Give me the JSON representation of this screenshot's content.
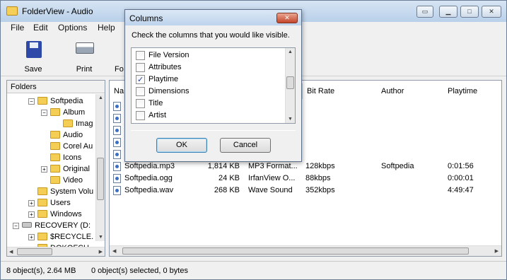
{
  "window": {
    "title": "FolderView - Audio"
  },
  "menu": {
    "items": [
      "File",
      "Edit",
      "Options",
      "Help"
    ]
  },
  "toolbar": {
    "buttons": [
      {
        "label": "Save"
      },
      {
        "label": "Print"
      },
      {
        "label": "Fo"
      }
    ]
  },
  "folders": {
    "header": "Folders",
    "tree": [
      {
        "label": "Softpedia",
        "expander": "−"
      },
      {
        "label": "Album",
        "expander": "−"
      },
      {
        "label": "Imag",
        "expander": ""
      },
      {
        "label": "Audio",
        "expander": ""
      },
      {
        "label": "Corel Au",
        "expander": ""
      },
      {
        "label": "Icons",
        "expander": ""
      },
      {
        "label": "Original",
        "expander": "+"
      },
      {
        "label": "Video",
        "expander": ""
      },
      {
        "label": "System Volu",
        "expander": ""
      },
      {
        "label": "Users",
        "expander": "+"
      },
      {
        "label": "Windows",
        "expander": "+"
      },
      {
        "label": "RECOVERY (D:",
        "expander": "−"
      },
      {
        "label": "$RECYCLE.",
        "expander": "+"
      },
      {
        "label": "DOKOFCH",
        "expander": ""
      }
    ]
  },
  "list": {
    "columns": [
      "Na",
      "Bit Rate",
      "Author",
      "Playtime"
    ],
    "files": [
      {
        "name": "Softpedia.mp3",
        "size": "1,814 KB",
        "type": "MP3 Format...",
        "bitrate": "128kbps",
        "author": "Softpedia",
        "playtime": "0:01:56"
      },
      {
        "name": "Softpedia.ogg",
        "size": "24 KB",
        "type": "IrfanView O...",
        "bitrate": "88kbps",
        "author": "",
        "playtime": "0:00:01"
      },
      {
        "name": "Softpedia.wav",
        "size": "268 KB",
        "type": "Wave Sound",
        "bitrate": "352kbps",
        "author": "",
        "playtime": "4:49:47"
      }
    ]
  },
  "status": {
    "left": "8 object(s), 2.64 MB",
    "right": "0 object(s) selected, 0 bytes"
  },
  "dialog": {
    "title": "Columns",
    "instruction": "Check the columns that you would like visible.",
    "options": [
      {
        "label": "File Version",
        "checked": false
      },
      {
        "label": "Attributes",
        "checked": false
      },
      {
        "label": "Playtime",
        "checked": true
      },
      {
        "label": "Dimensions",
        "checked": false
      },
      {
        "label": "Title",
        "checked": false
      },
      {
        "label": "Artist",
        "checked": false
      }
    ],
    "ok_label": "OK",
    "cancel_label": "Cancel"
  }
}
